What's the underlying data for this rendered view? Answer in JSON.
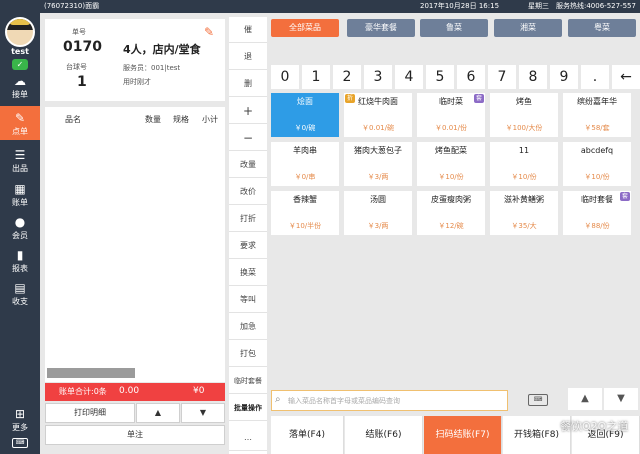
{
  "topbar": {
    "store": "(76072310)面霸",
    "datetime": "2017年10月28日 16:15",
    "weekday": "星期三",
    "hotline": "服务热线:4006-527-557"
  },
  "nav": {
    "user": "test",
    "online": "✓",
    "items": [
      {
        "label": "接单",
        "icon": "cloud-download-icon"
      },
      {
        "label": "点单",
        "icon": "edit-icon"
      },
      {
        "label": "出品",
        "icon": "list-icon"
      },
      {
        "label": "账单",
        "icon": "grid-icon"
      },
      {
        "label": "会员",
        "icon": "user-icon"
      },
      {
        "label": "报表",
        "icon": "bar-chart-icon"
      },
      {
        "label": "收支",
        "icon": "ledger-icon"
      },
      {
        "label": "更多",
        "icon": "apps-icon"
      }
    ],
    "keyboard": "⌨"
  },
  "order": {
    "order_no_label": "单号",
    "order_no": "0170",
    "table_label": "台球号",
    "table_no": "1",
    "guests": "4人，店内/堂食",
    "waiter": "服务员：001|test",
    "time": "用时刚才"
  },
  "list": {
    "headers": [
      "品名",
      "数量",
      "规格",
      "小计"
    ],
    "total_label": "账单合计:0条",
    "total_amount": "0.00",
    "total_yen": "¥0",
    "print_detail": "打印明细",
    "up": "▲",
    "down": "▼",
    "note": "单注"
  },
  "ops": [
    "催",
    "退",
    "删",
    "+",
    "−",
    "改量",
    "改价",
    "打折",
    "要求",
    "换菜",
    "等叫",
    "加急",
    "打包",
    "临时套餐",
    "批量操作",
    "…"
  ],
  "categories": [
    "全部菜品",
    "豪华套餐",
    "鲁菜",
    "湘菜",
    "粤菜"
  ],
  "numpad": [
    "0",
    "1",
    "2",
    "3",
    "4",
    "5",
    "6",
    "7",
    "8",
    "9",
    ".",
    "←"
  ],
  "dishes": [
    {
      "name": "烩面",
      "price": "￥0/碗",
      "selected": true
    },
    {
      "name": "红烧牛肉面",
      "price": "￥0.01/碗",
      "badge": "折"
    },
    {
      "name": "临时菜",
      "price": "￥0.01/份",
      "badge": "套"
    },
    {
      "name": "烤鱼",
      "price": "￥100/大份"
    },
    {
      "name": "缤纷嘉年华",
      "price": "￥58/套"
    },
    {
      "name": "羊肉串",
      "price": "￥0/串"
    },
    {
      "name": "猪肉大葱包子",
      "price": "￥3/两"
    },
    {
      "name": "烤鱼配菜",
      "price": "￥10/份"
    },
    {
      "name": "11",
      "price": "￥10/份"
    },
    {
      "name": "abcdefq",
      "price": "￥10/份"
    },
    {
      "name": "香辣蟹",
      "price": "￥10/半份"
    },
    {
      "name": "汤圆",
      "price": "￥3/两"
    },
    {
      "name": "皮蛋瘦肉粥",
      "price": "￥12/碗"
    },
    {
      "name": "滋补黄鳝粥",
      "price": "￥35/大"
    },
    {
      "name": "临时套餐",
      "price": "￥88/份",
      "badge": "套"
    }
  ],
  "search": {
    "placeholder": "输入菜品名称首字母或菜品编码查询"
  },
  "actions": [
    "落单(F4)",
    "结账(F6)",
    "扫码结账(F7)",
    "开钱箱(F8)",
    "返回(F9)"
  ],
  "watermark": "餐饮O2O之道"
}
